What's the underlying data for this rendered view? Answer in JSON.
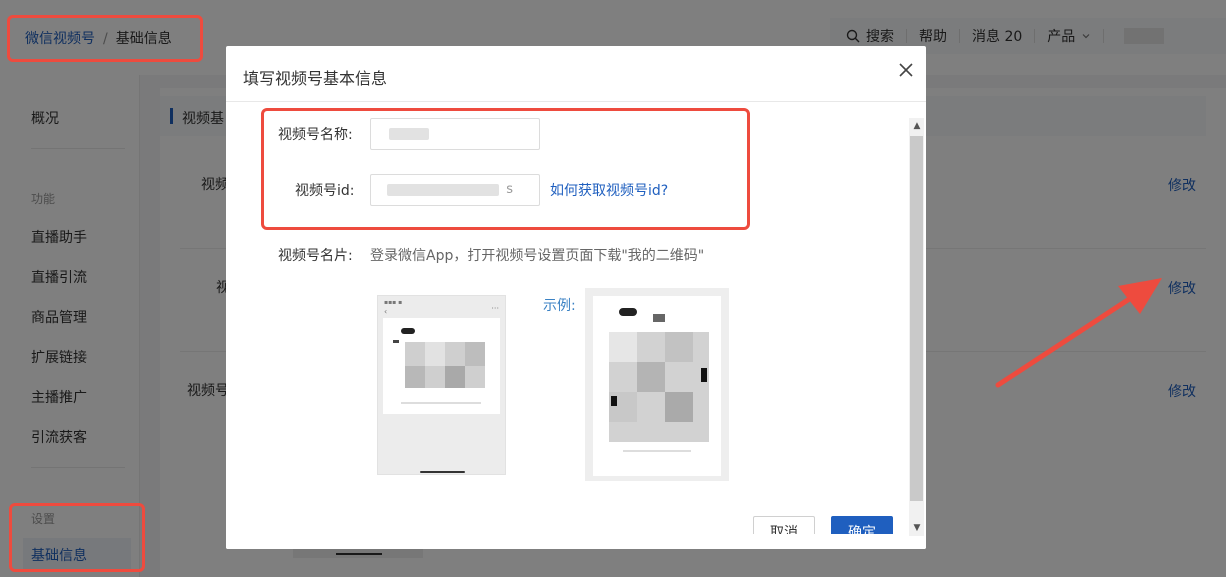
{
  "breadcrumb": {
    "parent": "微信视频号",
    "separator": "/",
    "current": "基础信息"
  },
  "toolbar": {
    "search": "搜索",
    "help": "帮助",
    "messages": "消息 20",
    "product": "产品"
  },
  "sidebar": {
    "overview": "概况",
    "features_group": "功能",
    "items": [
      "直播助手",
      "直播引流",
      "商品管理",
      "扩展链接",
      "主播推广",
      "引流获客"
    ],
    "settings_group": "设置",
    "active_item": "基础信息"
  },
  "content": {
    "section_title": "视频基",
    "row1_label": "视频",
    "row2_label": "视",
    "row3_label": "视频号",
    "edit_label": "修改"
  },
  "dialog": {
    "title": "填写视频号基本信息",
    "name_label": "视频号名称:",
    "id_label": "视频号id:",
    "id_value_tail": "s",
    "help_link": "如何获取视频号id?",
    "card_label": "视频号名片:",
    "card_desc": "登录微信App，打开视频号设置页面下载\"我的二维码\"",
    "example_label": "示例:",
    "cancel": "取消",
    "confirm": "确定"
  },
  "colors": {
    "accent": "#1f5fbf",
    "annotation_red": "#ee4b3e",
    "mask": "rgba(0,0,0,0.5)"
  },
  "icons": {
    "search": "search-icon",
    "chevron": "chevron-down-icon",
    "close": "close-icon"
  }
}
